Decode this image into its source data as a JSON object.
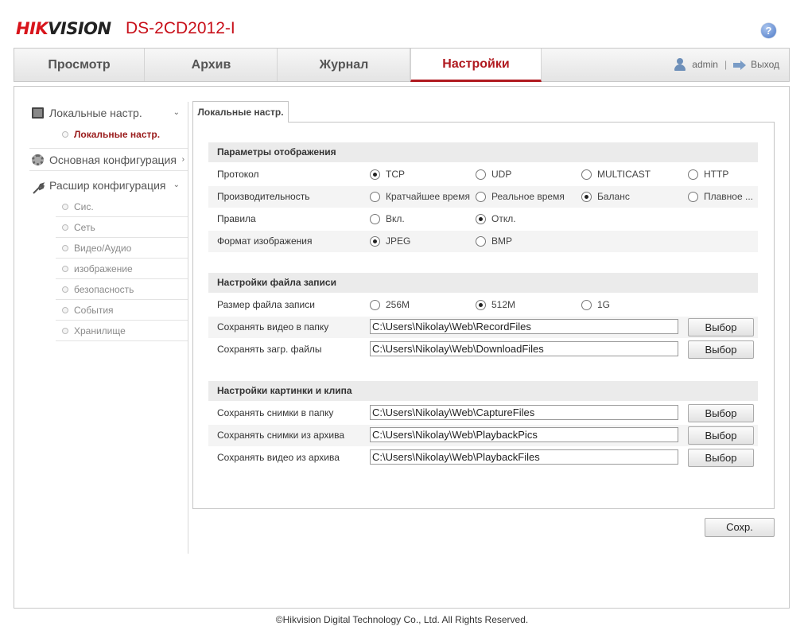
{
  "header": {
    "brand_red": "HIK",
    "brand_dark": "VISION",
    "model": "DS-2CD2012-I",
    "help_label": "?"
  },
  "nav": {
    "tabs": [
      {
        "label": "Просмотр",
        "active": false
      },
      {
        "label": "Архив",
        "active": false
      },
      {
        "label": "Журнал",
        "active": false
      },
      {
        "label": "Настройки",
        "active": true
      }
    ],
    "user": "admin",
    "separator": "|",
    "logout": "Выход"
  },
  "sidebar": {
    "local": {
      "label": "Локальные настр.",
      "icon": "monitor-icon",
      "chevron": "⌄"
    },
    "local_items": [
      {
        "label": "Локальные настр.",
        "active": true
      }
    ],
    "basic": {
      "label": "Основная конфигурация",
      "icon": "gear-icon",
      "chevron": "›"
    },
    "advanced": {
      "label": "Расшир конфигурация",
      "icon": "wrench-icon",
      "chevron": "⌄"
    },
    "advanced_items": [
      {
        "label": "Сис."
      },
      {
        "label": "Сеть"
      },
      {
        "label": "Видео/Аудио"
      },
      {
        "label": "изображение"
      },
      {
        "label": "безопасность"
      },
      {
        "label": "События"
      },
      {
        "label": "Хранилище"
      }
    ]
  },
  "content_tab": "Локальные настр.",
  "display": {
    "header": "Параметры отображения",
    "protocol": {
      "label": "Протокол",
      "options": [
        "TCP",
        "UDP",
        "MULTICAST",
        "HTTP"
      ],
      "selected": "TCP"
    },
    "performance": {
      "label": "Производительность",
      "options": [
        "Кратчайшее время",
        "Реальное время",
        "Баланс",
        "Плавное ..."
      ],
      "selected": "Баланс"
    },
    "rules": {
      "label": "Правила",
      "options": [
        "Вкл.",
        "Откл."
      ],
      "selected": "Откл."
    },
    "image_format": {
      "label": "Формат изображения",
      "options": [
        "JPEG",
        "BMP"
      ],
      "selected": "JPEG"
    }
  },
  "record": {
    "header": "Настройки файла записи",
    "file_size": {
      "label": "Размер файла записи",
      "options": [
        "256M",
        "512M",
        "1G"
      ],
      "selected": "512M"
    },
    "save_video": {
      "label": "Сохранять видео в папку",
      "value": "C:\\Users\\Nikolay\\Web\\RecordFiles",
      "button": "Выбор"
    },
    "save_downloads": {
      "label": "Сохранять загр. файлы",
      "value": "C:\\Users\\Nikolay\\Web\\DownloadFiles",
      "button": "Выбор"
    }
  },
  "picture": {
    "header": "Настройки картинки и клипа",
    "snapshots": {
      "label": "Сохранять снимки в папку",
      "value": "C:\\Users\\Nikolay\\Web\\CaptureFiles",
      "button": "Выбор"
    },
    "playback_pics": {
      "label": "Сохранять снимки из архива",
      "value": "C:\\Users\\Nikolay\\Web\\PlaybackPics",
      "button": "Выбор"
    },
    "playback_video": {
      "label": "Сохранять видео из архива",
      "value": "C:\\Users\\Nikolay\\Web\\PlaybackFiles",
      "button": "Выбор"
    }
  },
  "save_button": "Сохр.",
  "footer": "©Hikvision Digital Technology Co., Ltd. All Rights Reserved.",
  "colors": {
    "brand_red": "#d8141b",
    "active_tab": "#b0191f",
    "active_side_item": "#9a1c1c"
  }
}
